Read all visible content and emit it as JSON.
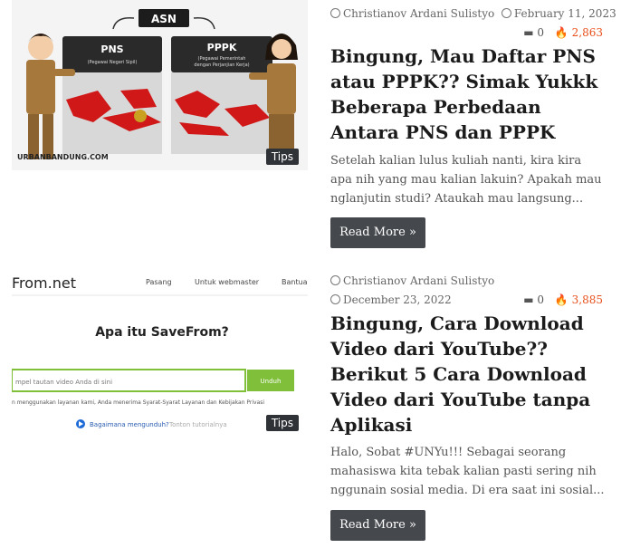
{
  "posts": [
    {
      "category_badge": "Tips",
      "author": "Christianov Ardani Sulistyo",
      "date": "February 11, 2023",
      "comments": "0",
      "views": "2,863",
      "title": "Bingung, Mau Daftar PNS atau PPPK?? Simak Yukkk Beberapa Perbedaan Antara PNS dan PPPK",
      "excerpt": "Setelah kalian lulus kuliah nanti, kira kira apa nih yang mau kalian lakuin? Apakah mau nglanjutin studi? Ataukah mau langsung...",
      "read_more": "Read More »",
      "image": {
        "top_label": "ASN",
        "left_box_title": "PNS",
        "left_box_sub": "(Pegawai Negeri Sipil)",
        "right_box_title": "PPPK",
        "right_box_sub_1": "(Pegawai Pemerintah",
        "right_box_sub_2": "dengan Perjanjian Kerja)",
        "watermark": "URBANBANDUNG.COM"
      }
    },
    {
      "category_badge": "Tips",
      "author": "Christianov Ardani Sulistyo",
      "date": "December 23, 2022",
      "comments": "0",
      "views": "3,885",
      "title": "Bingung, Cara Download Video dari YouTube?? Berikut 5 Cara Download Video dari YouTube tanpa Aplikasi",
      "excerpt": "Halo, Sobat #UNYu!!! Sebagai seorang mahasiswa kita tebak kalian pasti sering nih nggunain sosial media. Di era saat ini sosial...",
      "read_more": "Read More »",
      "image": {
        "site_logo": "From.net",
        "nav_1": "Pasang",
        "nav_2": "Untuk webmaster",
        "nav_3": "Bantua",
        "heading": "Apa itu SaveFrom?",
        "input_placeholder": "mpel tautan video Anda di sini",
        "button": "Unduh",
        "terms": "n menggunakan layanan kami, Anda menerima Syarat-Syarat Layanan dan Kebijakan Privasi",
        "howto": "Bagaimana mengunduh?",
        "howto_sub": "Tonton tutorialnya"
      }
    }
  ],
  "colors": {
    "accent_views": "#e8501c",
    "button_bg": "#45484d",
    "badge_bg": "#2f3338"
  }
}
